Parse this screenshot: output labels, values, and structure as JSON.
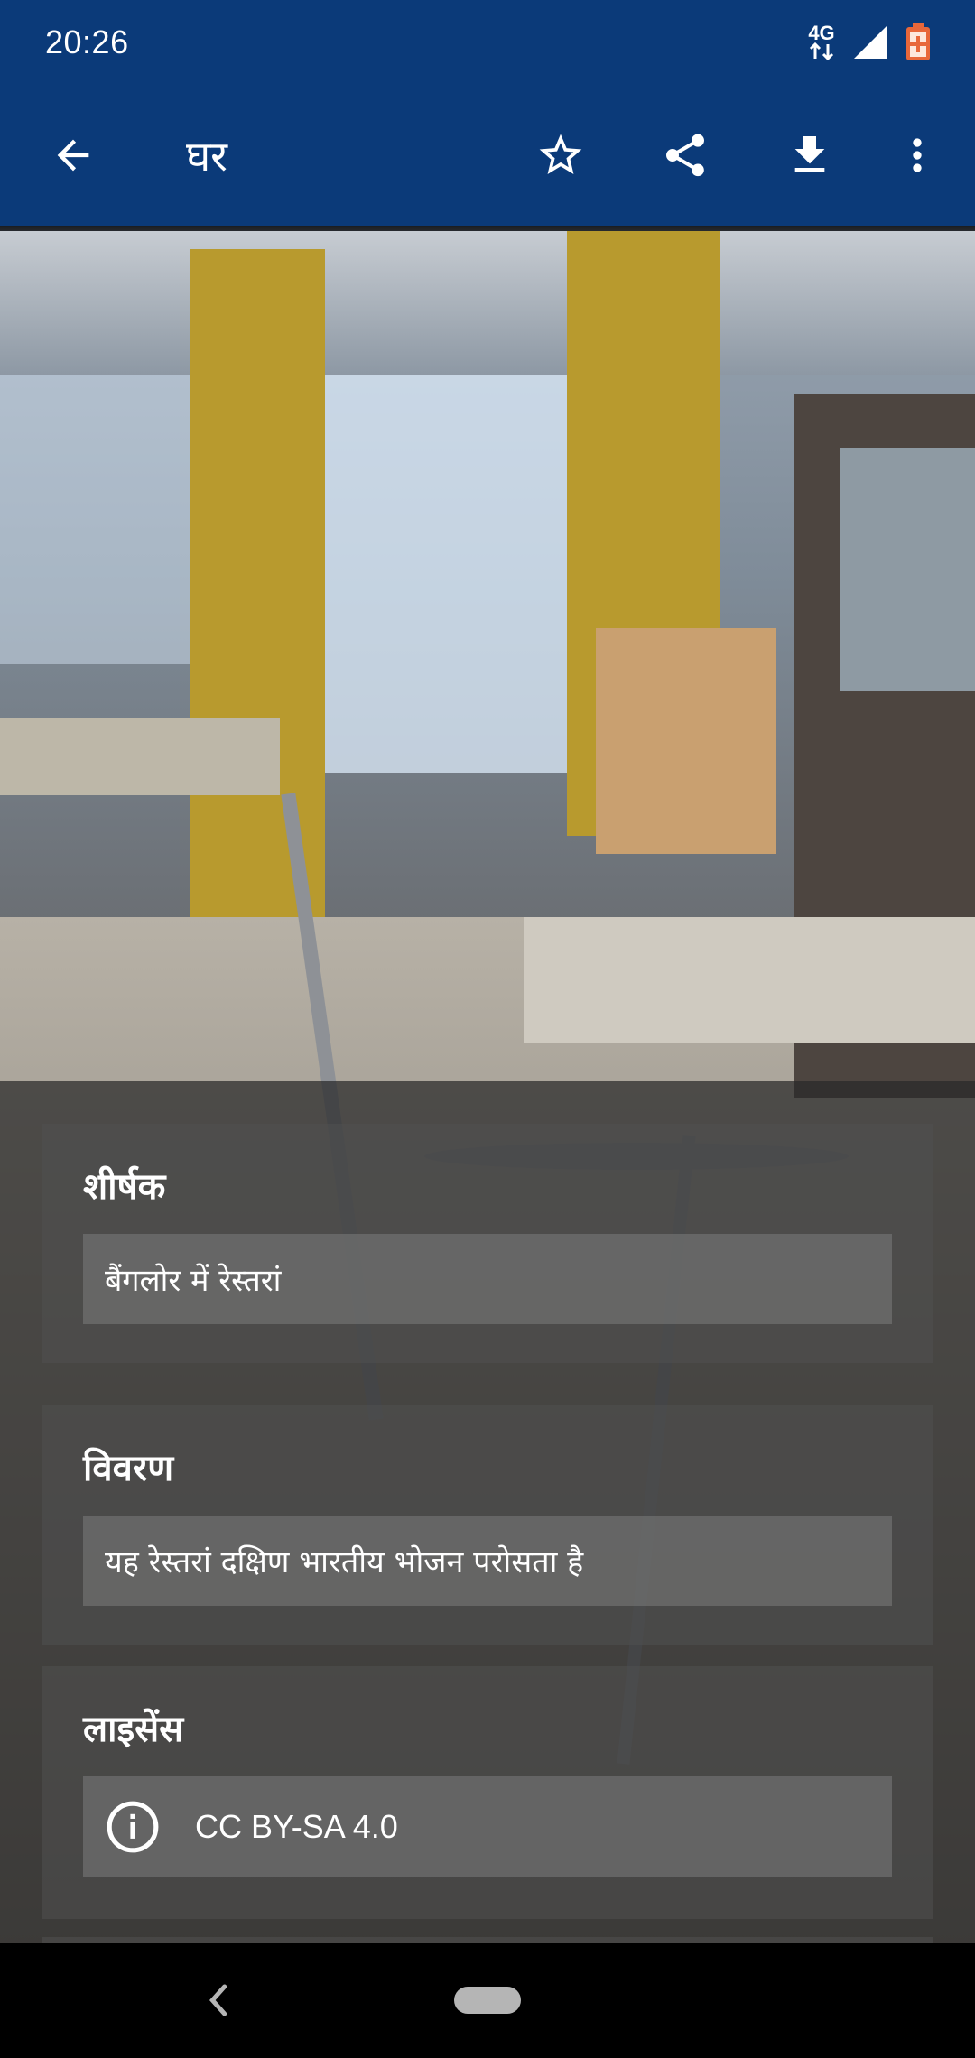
{
  "status_bar": {
    "time": "20:26",
    "network_label": "4G",
    "icons": [
      "network-arrows-icon",
      "signal-icon",
      "battery-icon"
    ]
  },
  "app_bar": {
    "title": "घर",
    "back_icon": "arrow-back-icon",
    "actions": [
      "star-icon",
      "share-icon",
      "download-icon",
      "more-vert-icon"
    ]
  },
  "details": {
    "title_card": {
      "heading": "शीर्षक",
      "value": "बैंगलोर में रेस्तरां"
    },
    "description_card": {
      "heading": "विवरण",
      "value": "यह रेस्तरां दक्षिण भारतीय भोजन परोसता है"
    },
    "license_card": {
      "heading": "लाइसेंस",
      "value": "CC BY-SA 4.0",
      "icon": "info-icon"
    }
  },
  "nav_bar": {
    "icons": [
      "nav-back-icon",
      "nav-home-pill"
    ]
  },
  "colors": {
    "primary": "#0b3a79",
    "nav_bar": "#000000"
  }
}
